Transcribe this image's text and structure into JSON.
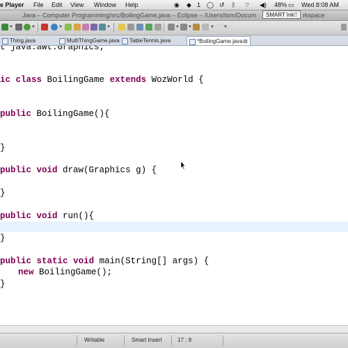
{
  "menubar": {
    "app": "e Player",
    "items": [
      "File",
      "Edit",
      "View",
      "Window",
      "Help"
    ],
    "battery": "48%",
    "clock": "Wed 8:08 AM"
  },
  "window": {
    "title": "Java – Computer Programming/src/BoilingGame.java – Eclipse – /Users/tom/Docum",
    "title_tail": "rkspace"
  },
  "smart_ink": {
    "label": "SMART Ink",
    "grip": "⠿"
  },
  "tabs": [
    {
      "label": "Thing.java",
      "close": ""
    },
    {
      "label": "MultiThingGame.java",
      "close": ""
    },
    {
      "label": "TableTennis.java",
      "close": ""
    },
    {
      "label": "*BoilingGame.java",
      "close": "⊠"
    }
  ],
  "code": {
    "import_line": "t java.awt.Graphics;",
    "class_kw1": "ic ",
    "class_kw2": "class",
    "class_name": " BoilingGame ",
    "extends_kw": "extends",
    "class_rest": " WozWorld {",
    "ctor_kw": "public",
    "ctor_rest": " BoilingGame(){",
    "close_brace": "}",
    "draw_kw1": "public",
    "draw_kw2": "void",
    "draw_rest": " draw(Graphics g) {",
    "run_kw1": "public",
    "run_kw2": "void",
    "run_rest": " run(){",
    "main_kw1": "public",
    "main_kw2": "static",
    "main_kw3": "void",
    "main_rest": " main(String[] args) {",
    "new_kw": "new",
    "new_rest": " BoilingGame();"
  },
  "status": {
    "writable": "Writable",
    "insert_mode": "Smart Insert",
    "position": "17 : 9"
  }
}
